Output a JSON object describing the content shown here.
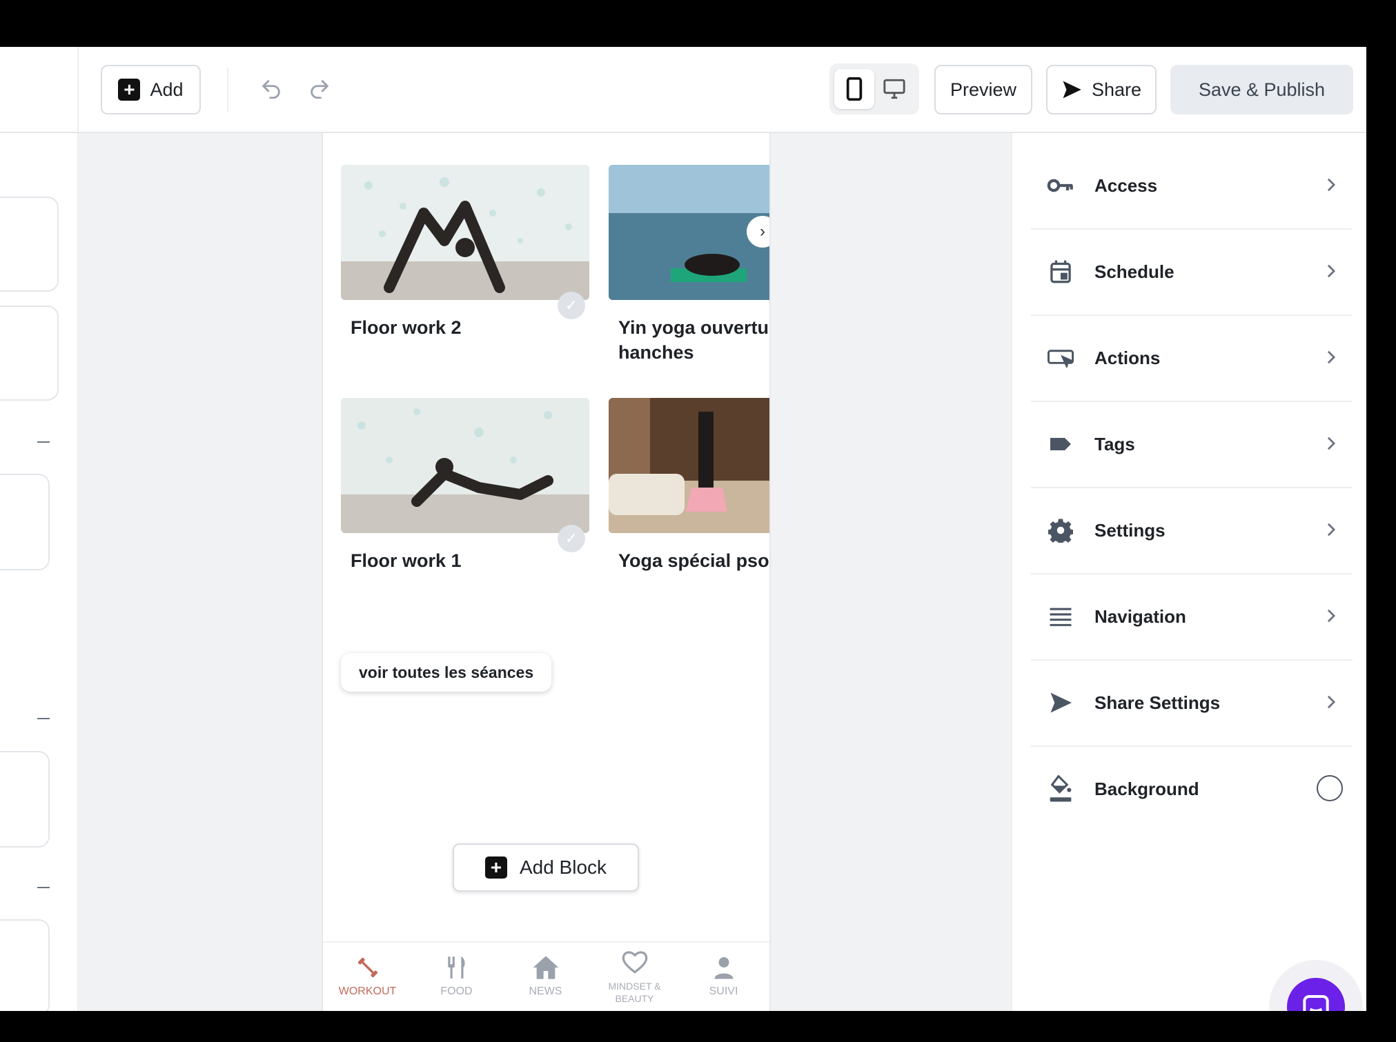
{
  "toolbar": {
    "add_label": "Add",
    "preview_label": "Preview",
    "share_label": "Share",
    "publish_label": "Save & Publish"
  },
  "canvas": {
    "cards": [
      {
        "title": "Floor work 2",
        "selected": true
      },
      {
        "title": "Yin yoga ouvertur hanches",
        "selected": false
      },
      {
        "title": "Floor work 1",
        "selected": true
      },
      {
        "title": "Yoga spécial psoa:",
        "selected": false
      }
    ],
    "see_all_label": "voir toutes les séances",
    "add_block_label": "Add Block",
    "tabs": [
      {
        "label": "WORKOUT",
        "icon": "dumbbell-icon",
        "active": true
      },
      {
        "label": "FOOD",
        "icon": "cutlery-icon",
        "active": false
      },
      {
        "label": "NEWS",
        "icon": "home-icon",
        "active": false
      },
      {
        "label": "MINDSET & BEAUTY",
        "icon": "heart-icon",
        "active": false
      },
      {
        "label": "SUIVI",
        "icon": "person-icon",
        "active": false
      }
    ]
  },
  "settings_panel": {
    "items": [
      {
        "label": "Access",
        "icon": "key-icon"
      },
      {
        "label": "Schedule",
        "icon": "calendar-icon"
      },
      {
        "label": "Actions",
        "icon": "cursor-box-icon"
      },
      {
        "label": "Tags",
        "icon": "tag-icon"
      },
      {
        "label": "Settings",
        "icon": "gear-icon"
      },
      {
        "label": "Navigation",
        "icon": "menu-lines-icon"
      },
      {
        "label": "Share Settings",
        "icon": "send-icon"
      },
      {
        "label": "Background",
        "icon": "paint-bucket-icon"
      }
    ]
  },
  "colors": {
    "accent": "#6b21e8",
    "active_tab": "#c26a5a",
    "publish_bg": "#e8ebef"
  }
}
